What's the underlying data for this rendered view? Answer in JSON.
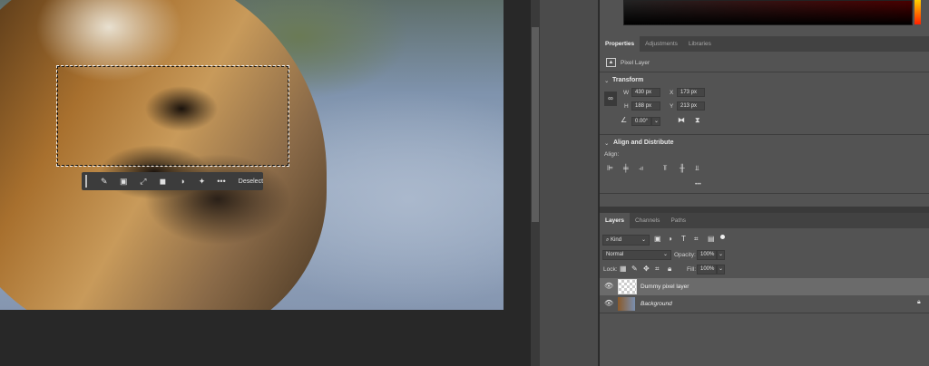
{
  "context_bar": {
    "deselect": "Deselect",
    "more": "•••"
  },
  "properties": {
    "tabs": [
      "Properties",
      "Adjustments",
      "Libraries"
    ],
    "layer_type": "Pixel Layer",
    "transform": {
      "title": "Transform",
      "w_label": "W",
      "w": "430 px",
      "h_label": "H",
      "h": "188 px",
      "x_label": "X",
      "x": "173 px",
      "y_label": "Y",
      "y": "213 px",
      "angle": "0.00°"
    },
    "align": {
      "title": "Align and Distribute",
      "label": "Align:",
      "more": "•••"
    }
  },
  "layers": {
    "tabs": [
      "Layers",
      "Channels",
      "Paths"
    ],
    "filter": "Kind",
    "blend_mode": "Normal",
    "opacity_label": "Opacity:",
    "opacity": "100%",
    "lock_label": "Lock:",
    "fill_label": "Fill:",
    "fill": "100%",
    "items": [
      {
        "name": "Dummy pixel layer",
        "selected": true
      },
      {
        "name": "Background",
        "locked": true
      }
    ]
  }
}
